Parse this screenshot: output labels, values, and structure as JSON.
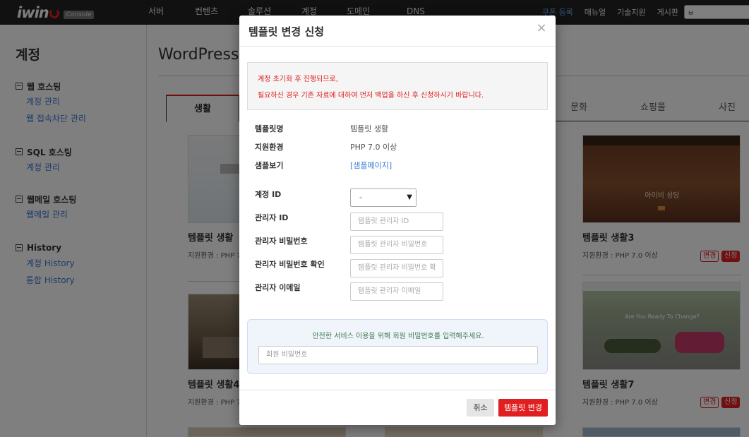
{
  "header": {
    "logo_text": "iwin",
    "logo_badge": "Console",
    "main_nav": [
      "서버",
      "컨텐츠",
      "솔루션",
      "계정",
      "도메인",
      "DNS"
    ],
    "util_nav": [
      "쿠폰 등록",
      "매뉴얼",
      "기술지원",
      "게시판"
    ],
    "search_value": "ㅂ"
  },
  "sidebar": {
    "title": "계정",
    "groups": [
      {
        "label": "웹 호스팅",
        "links": [
          "계정 관리",
          "웹 접속차단 관리"
        ]
      },
      {
        "label": "SQL 호스팅",
        "links": [
          "계정 관리"
        ]
      },
      {
        "label": "웹메일 호스팅",
        "links": [
          "웹메일 관리"
        ]
      },
      {
        "label": "History",
        "links": [
          "계정 History",
          "통합 History"
        ]
      }
    ]
  },
  "main": {
    "title": "WordPress",
    "tabs": [
      "생활",
      "문화",
      "쇼핑몰",
      "사진"
    ],
    "cards": [
      {
        "name": "템플릿 생활",
        "env": "지원환경 : PHP 7"
      },
      {
        "name": "템플릿 생활3",
        "env": "지원환경 : PHP 7.0 이상",
        "thumb_text": "아이비 성당",
        "btn_change": "변경",
        "btn_apply": "신청"
      },
      {
        "name": "템플릿 생활4",
        "env": "지원환경 : PHP 7"
      },
      {
        "name": "템플릿 생활7",
        "env": "지원환경 : PHP 7.0 이상",
        "thumb_text": "Are You Ready To Change?",
        "btn_change": "변경",
        "btn_apply": "신청"
      }
    ]
  },
  "modal": {
    "title": "템플릿 변경 신청",
    "close": "×",
    "alert_line1": "계정 초기화 후 진행되므로,",
    "alert_line2": "필요하신 경우 기존 자료에 대하여 먼저 백업을 하신 후 신청하시기 바랍니다.",
    "info": [
      {
        "label": "템플릿명",
        "value": "템플릿 생활"
      },
      {
        "label": "지원환경",
        "value": "PHP 7.0 이상"
      },
      {
        "label": "샘플보기",
        "value": "[샘플페이지]"
      }
    ],
    "account_id": {
      "label": "계정 ID",
      "selected": "-"
    },
    "fields": [
      {
        "label": "관리자 ID",
        "placeholder": "템플릿 관리자 ID"
      },
      {
        "label": "관리자 비밀번호",
        "placeholder": "템플릿 관리자 비밀번호"
      },
      {
        "label": "관리자 비밀번호 확인",
        "placeholder": "템플릿 관리자 비밀번호 확"
      },
      {
        "label": "관리자 이메일",
        "placeholder": "템플릿 관리자 이메일"
      }
    ],
    "verify_text": "안전한 서비스 이용을 위해 회원 비밀번호를 입력해주세요.",
    "verify_placeholder": "회원 비밀번호",
    "cancel_label": "취소",
    "submit_label": "템플릿 변경"
  }
}
